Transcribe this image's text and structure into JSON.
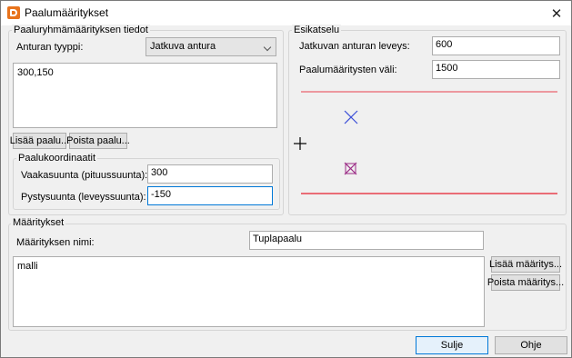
{
  "window": {
    "title": "Paalumääritykset",
    "close_label": "✕"
  },
  "pile_group": {
    "title": "Paaluryhmämäärityksen tiedot",
    "footing_type_label": "Anturan tyyppi:",
    "footing_type_value": "Jatkuva antura",
    "pile_list": [
      "300,150"
    ],
    "add_pile_label": "Lisää paalu...",
    "remove_pile_label": "Poista paalu..."
  },
  "coordinates": {
    "title": "Paalukoordinaatit",
    "horizontal_label": "Vaakasuunta (pituussuunta):",
    "horizontal_value": "300",
    "vertical_label": "Pystysuunta (leveyssuunta):",
    "vertical_value": "-150"
  },
  "preview": {
    "title": "Esikatselu",
    "width_label": "Jatkuvan anturan leveys:",
    "width_value": "600",
    "spacing_label": "Paalumääritysten väli:",
    "spacing_value": "1500",
    "colors": {
      "edge_line": "#e8404e",
      "pile_marker": "#3b4fd8",
      "selected_marker": "#9b2c86",
      "origin": "#000000"
    }
  },
  "definitions": {
    "title": "Määritykset",
    "name_label": "Määrityksen nimi:",
    "name_value": "Tuplapaalu",
    "list": [
      "malli"
    ],
    "add_label": "Lisää määritys...",
    "remove_label": "Poista määritys..."
  },
  "footer": {
    "close_label": "Sulje",
    "help_label": "Ohje"
  }
}
